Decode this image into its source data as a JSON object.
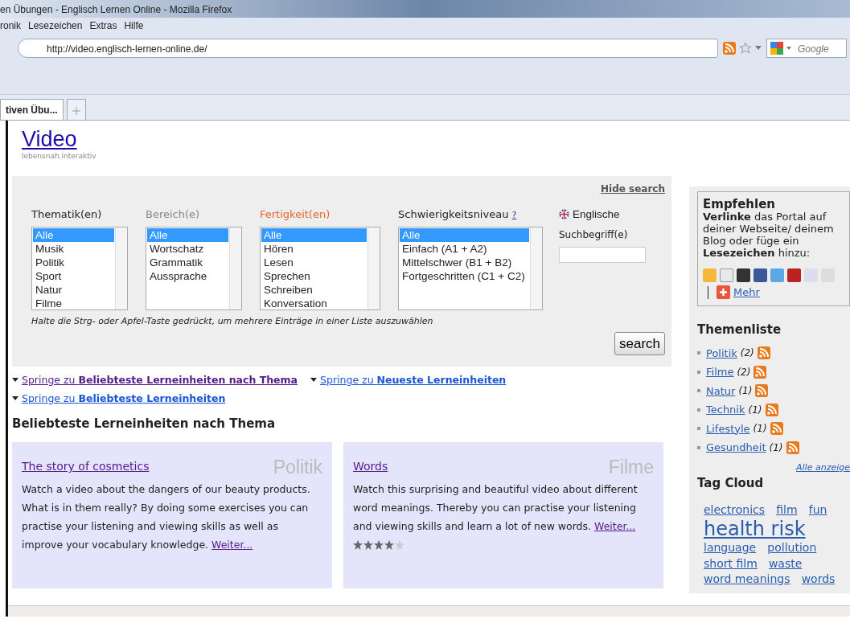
{
  "window": {
    "title": "en Übungen - Englisch Lernen Online - Mozilla Firefox"
  },
  "menu": [
    "ronik",
    "Lesezeichen",
    "Extras",
    "Hilfe"
  ],
  "address_bar": {
    "url": "http://video.englisch-lernen-online.de/"
  },
  "web_search": {
    "placeholder": "Google"
  },
  "tabs": [
    {
      "label": "tiven Übu...",
      "selected": true
    }
  ],
  "page": {
    "site_title": "Video",
    "tagline": "lebensnah.interaktiv",
    "search": {
      "hide_link": "Hide search",
      "filters": [
        {
          "label": "Thematik(en)",
          "color": "#222222",
          "options": [
            {
              "label": "Alle",
              "selected": true
            },
            {
              "label": "Musik",
              "selected": false
            },
            {
              "label": "Politik",
              "selected": false
            },
            {
              "label": "Sport",
              "selected": false
            },
            {
              "label": "Natur",
              "selected": false
            },
            {
              "label": "Filme",
              "selected": false
            }
          ]
        },
        {
          "label": "Bereich(e)",
          "color": "#888888",
          "options": [
            {
              "label": "Alle",
              "selected": true
            },
            {
              "label": "Wortschatz",
              "selected": false
            },
            {
              "label": "Grammatik",
              "selected": false
            },
            {
              "label": "Aussprache",
              "selected": false
            }
          ]
        },
        {
          "label": "Fertigkeit(en)",
          "color": "#e8642c",
          "options": [
            {
              "label": "Alle",
              "selected": true
            },
            {
              "label": "Hören",
              "selected": false
            },
            {
              "label": "Lesen",
              "selected": false
            },
            {
              "label": "Sprechen",
              "selected": false
            },
            {
              "label": "Schreiben",
              "selected": false
            },
            {
              "label": "Konversation",
              "selected": false
            }
          ]
        },
        {
          "label": "Schwierigkeitsniveau",
          "help": "?",
          "color": "#222222",
          "options": [
            {
              "label": "Alle",
              "selected": true
            },
            {
              "label": "Einfach (A1 + A2)",
              "selected": false
            },
            {
              "label": "Mittelschwer (B1 + B2)",
              "selected": false
            },
            {
              "label": "Fortgeschritten (C1 + C2)",
              "selected": false
            }
          ]
        }
      ],
      "language": "Englische",
      "term_label": "Suchbegriff(e)",
      "hint": "Halte die Strg- oder Apfel-Taste gedrückt, um mehrere Einträge in einer Liste auszuwählen",
      "button": "search"
    },
    "jump_links": [
      {
        "text": "Springe zu **Beliebteste Lerneinheiten nach Thema**",
        "visited": true
      },
      {
        "text": "Springe zu **Neueste Lerneinheiten**",
        "visited": false
      },
      {
        "text": "Springe zu **Beliebteste Lerneinheiten**",
        "visited": false
      }
    ],
    "section_heading": "Beliebteste Lerneinheiten nach Thema",
    "cards": [
      {
        "title": "The story of cosmetics",
        "category": "Politik",
        "text": "Watch a video about the dangers of our beauty products. What is in them really? By doing some exercises you can practise your listening and viewing skills as well as improve your vocabulary knowledge.",
        "link": "Weiter..."
      },
      {
        "title": "Words",
        "category": "Filme",
        "text": "Watch this surprising and beautiful video about different word meanings. Thereby you can practise your listening and viewing skills and learn a lot of new words.",
        "link": "Weiter...",
        "stars": 4
      }
    ]
  },
  "sidebar": {
    "recommend": {
      "title": "Empfehlen",
      "text": "**Verlinke** das Portal auf deiner Webseite/ deinem Blog oder füge ein **Lesezeichen** hinzu:",
      "more": "Mehr"
    },
    "themes": {
      "title": "Themenliste",
      "items": [
        {
          "name": "Politik",
          "count": "(2)"
        },
        {
          "name": "Filme",
          "count": "(2)"
        },
        {
          "name": "Natur",
          "count": "(1)"
        },
        {
          "name": "Technik",
          "count": "(1)"
        },
        {
          "name": "Lifestyle",
          "count": "(1)"
        },
        {
          "name": "Gesundheit",
          "count": "(1)"
        }
      ],
      "all_link": "Alle anzeige"
    },
    "tag_cloud": {
      "title": "Tag Cloud",
      "tags": [
        {
          "label": "electronics",
          "kind": "normal"
        },
        {
          "label": "film",
          "kind": "normal"
        },
        {
          "label": "fun",
          "kind": "normal"
        },
        {
          "label": "health risk",
          "kind": "large"
        },
        {
          "label": "language",
          "kind": "normal"
        },
        {
          "label": "pollution",
          "kind": "normal"
        },
        {
          "label": "short film",
          "kind": "normal"
        },
        {
          "label": "waste",
          "kind": "normal"
        },
        {
          "label": "word meanings",
          "kind": "normal"
        },
        {
          "label": "words",
          "kind": "normal"
        }
      ]
    }
  }
}
